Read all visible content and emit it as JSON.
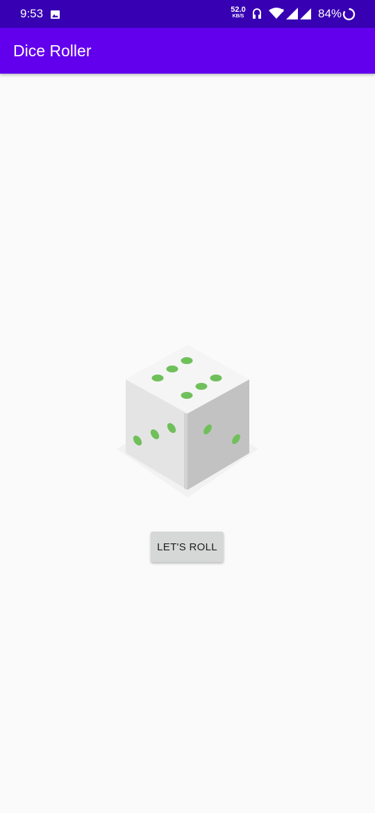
{
  "status_bar": {
    "time": "9:53",
    "net_speed_value": "52.0",
    "net_speed_unit": "KB/S",
    "battery_percent": "84%",
    "icons": [
      "gallery-icon",
      "headset-icon",
      "wifi-icon",
      "signal-icon",
      "battery-icon"
    ]
  },
  "app_bar": {
    "title": "Dice Roller",
    "color": "#6200ee",
    "status_color": "#3700b3"
  },
  "dice": {
    "face_value": 6,
    "pip_color": "#6fc05a"
  },
  "roll_button": {
    "label": "LET'S ROLL"
  }
}
